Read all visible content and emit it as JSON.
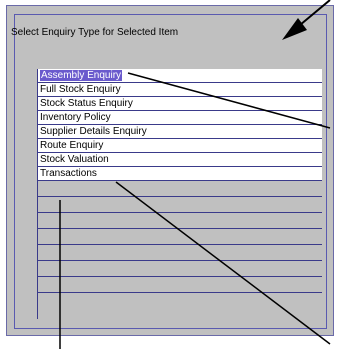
{
  "dialog": {
    "prompt": "Select Enquiry Type for Selected Item"
  },
  "list": {
    "items": [
      {
        "label": "Assembly Enquiry",
        "selected": true
      },
      {
        "label": "Full Stock Enquiry",
        "selected": false
      },
      {
        "label": "Stock Status Enquiry",
        "selected": false
      },
      {
        "label": "Inventory Policy",
        "selected": false
      },
      {
        "label": "Supplier Details Enquiry",
        "selected": false
      },
      {
        "label": "Route Enquiry",
        "selected": false
      },
      {
        "label": "Stock Valuation",
        "selected": false
      },
      {
        "label": "Transactions",
        "selected": false
      }
    ],
    "empty_rows": 7
  },
  "colors": {
    "selection": "#6a5acd",
    "panel": "#c0c0c0",
    "border": "#3a3a8a"
  }
}
